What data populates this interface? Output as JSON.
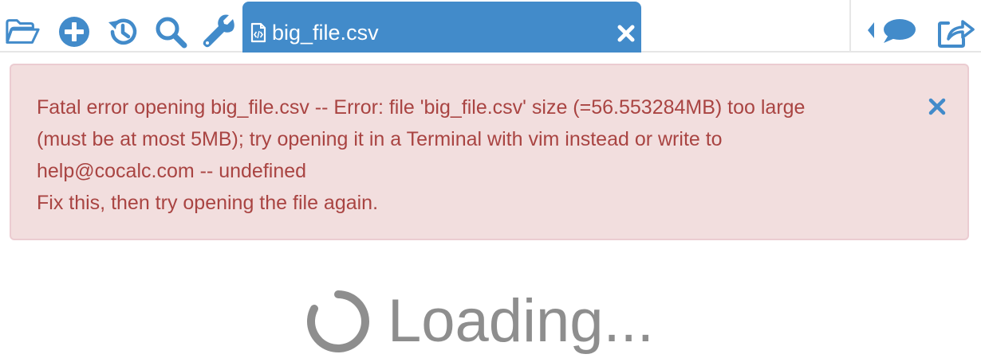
{
  "toolbar": {
    "icons": [
      {
        "name": "folder-open-icon"
      },
      {
        "name": "plus-circle-icon"
      },
      {
        "name": "history-icon"
      },
      {
        "name": "search-icon"
      },
      {
        "name": "wrench-icon"
      }
    ],
    "right_icons": [
      {
        "name": "chat-icon"
      },
      {
        "name": "share-icon"
      }
    ],
    "accent_color": "#428bca"
  },
  "tab": {
    "label": "big_file.csv",
    "icon": "code-file-icon",
    "close_icon": "close-icon"
  },
  "error": {
    "lines": [
      "Fatal error opening big_file.csv -- Error: file 'big_file.csv' size (=56.553284MB) too large",
      "(must be at most 5MB); try opening it in a Terminal with vim instead or write to",
      "help@cocalc.com -- undefined",
      "Fix this, then try opening the file again."
    ],
    "close_icon": "close-icon",
    "background_color": "#f2dede",
    "text_color": "#a94442"
  },
  "loading": {
    "label": "Loading...",
    "icon": "spinner-icon"
  }
}
